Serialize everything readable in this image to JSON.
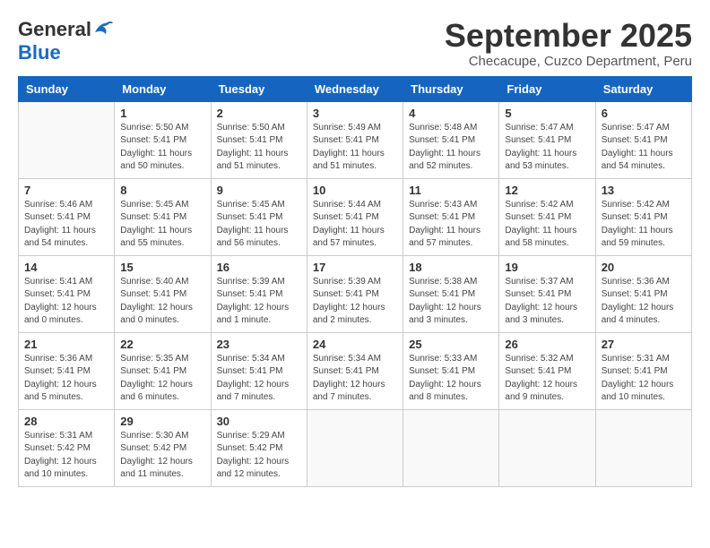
{
  "header": {
    "logo_general": "General",
    "logo_blue": "Blue",
    "month_title": "September 2025",
    "subtitle": "Checacupe, Cuzco Department, Peru"
  },
  "weekdays": [
    "Sunday",
    "Monday",
    "Tuesday",
    "Wednesday",
    "Thursday",
    "Friday",
    "Saturday"
  ],
  "weeks": [
    [
      {
        "day": "",
        "detail": ""
      },
      {
        "day": "1",
        "detail": "Sunrise: 5:50 AM\nSunset: 5:41 PM\nDaylight: 11 hours\nand 50 minutes."
      },
      {
        "day": "2",
        "detail": "Sunrise: 5:50 AM\nSunset: 5:41 PM\nDaylight: 11 hours\nand 51 minutes."
      },
      {
        "day": "3",
        "detail": "Sunrise: 5:49 AM\nSunset: 5:41 PM\nDaylight: 11 hours\nand 51 minutes."
      },
      {
        "day": "4",
        "detail": "Sunrise: 5:48 AM\nSunset: 5:41 PM\nDaylight: 11 hours\nand 52 minutes."
      },
      {
        "day": "5",
        "detail": "Sunrise: 5:47 AM\nSunset: 5:41 PM\nDaylight: 11 hours\nand 53 minutes."
      },
      {
        "day": "6",
        "detail": "Sunrise: 5:47 AM\nSunset: 5:41 PM\nDaylight: 11 hours\nand 54 minutes."
      }
    ],
    [
      {
        "day": "7",
        "detail": "Sunrise: 5:46 AM\nSunset: 5:41 PM\nDaylight: 11 hours\nand 54 minutes."
      },
      {
        "day": "8",
        "detail": "Sunrise: 5:45 AM\nSunset: 5:41 PM\nDaylight: 11 hours\nand 55 minutes."
      },
      {
        "day": "9",
        "detail": "Sunrise: 5:45 AM\nSunset: 5:41 PM\nDaylight: 11 hours\nand 56 minutes."
      },
      {
        "day": "10",
        "detail": "Sunrise: 5:44 AM\nSunset: 5:41 PM\nDaylight: 11 hours\nand 57 minutes."
      },
      {
        "day": "11",
        "detail": "Sunrise: 5:43 AM\nSunset: 5:41 PM\nDaylight: 11 hours\nand 57 minutes."
      },
      {
        "day": "12",
        "detail": "Sunrise: 5:42 AM\nSunset: 5:41 PM\nDaylight: 11 hours\nand 58 minutes."
      },
      {
        "day": "13",
        "detail": "Sunrise: 5:42 AM\nSunset: 5:41 PM\nDaylight: 11 hours\nand 59 minutes."
      }
    ],
    [
      {
        "day": "14",
        "detail": "Sunrise: 5:41 AM\nSunset: 5:41 PM\nDaylight: 12 hours\nand 0 minutes."
      },
      {
        "day": "15",
        "detail": "Sunrise: 5:40 AM\nSunset: 5:41 PM\nDaylight: 12 hours\nand 0 minutes."
      },
      {
        "day": "16",
        "detail": "Sunrise: 5:39 AM\nSunset: 5:41 PM\nDaylight: 12 hours\nand 1 minute."
      },
      {
        "day": "17",
        "detail": "Sunrise: 5:39 AM\nSunset: 5:41 PM\nDaylight: 12 hours\nand 2 minutes."
      },
      {
        "day": "18",
        "detail": "Sunrise: 5:38 AM\nSunset: 5:41 PM\nDaylight: 12 hours\nand 3 minutes."
      },
      {
        "day": "19",
        "detail": "Sunrise: 5:37 AM\nSunset: 5:41 PM\nDaylight: 12 hours\nand 3 minutes."
      },
      {
        "day": "20",
        "detail": "Sunrise: 5:36 AM\nSunset: 5:41 PM\nDaylight: 12 hours\nand 4 minutes."
      }
    ],
    [
      {
        "day": "21",
        "detail": "Sunrise: 5:36 AM\nSunset: 5:41 PM\nDaylight: 12 hours\nand 5 minutes."
      },
      {
        "day": "22",
        "detail": "Sunrise: 5:35 AM\nSunset: 5:41 PM\nDaylight: 12 hours\nand 6 minutes."
      },
      {
        "day": "23",
        "detail": "Sunrise: 5:34 AM\nSunset: 5:41 PM\nDaylight: 12 hours\nand 7 minutes."
      },
      {
        "day": "24",
        "detail": "Sunrise: 5:34 AM\nSunset: 5:41 PM\nDaylight: 12 hours\nand 7 minutes."
      },
      {
        "day": "25",
        "detail": "Sunrise: 5:33 AM\nSunset: 5:41 PM\nDaylight: 12 hours\nand 8 minutes."
      },
      {
        "day": "26",
        "detail": "Sunrise: 5:32 AM\nSunset: 5:41 PM\nDaylight: 12 hours\nand 9 minutes."
      },
      {
        "day": "27",
        "detail": "Sunrise: 5:31 AM\nSunset: 5:41 PM\nDaylight: 12 hours\nand 10 minutes."
      }
    ],
    [
      {
        "day": "28",
        "detail": "Sunrise: 5:31 AM\nSunset: 5:42 PM\nDaylight: 12 hours\nand 10 minutes."
      },
      {
        "day": "29",
        "detail": "Sunrise: 5:30 AM\nSunset: 5:42 PM\nDaylight: 12 hours\nand 11 minutes."
      },
      {
        "day": "30",
        "detail": "Sunrise: 5:29 AM\nSunset: 5:42 PM\nDaylight: 12 hours\nand 12 minutes."
      },
      {
        "day": "",
        "detail": ""
      },
      {
        "day": "",
        "detail": ""
      },
      {
        "day": "",
        "detail": ""
      },
      {
        "day": "",
        "detail": ""
      }
    ]
  ]
}
